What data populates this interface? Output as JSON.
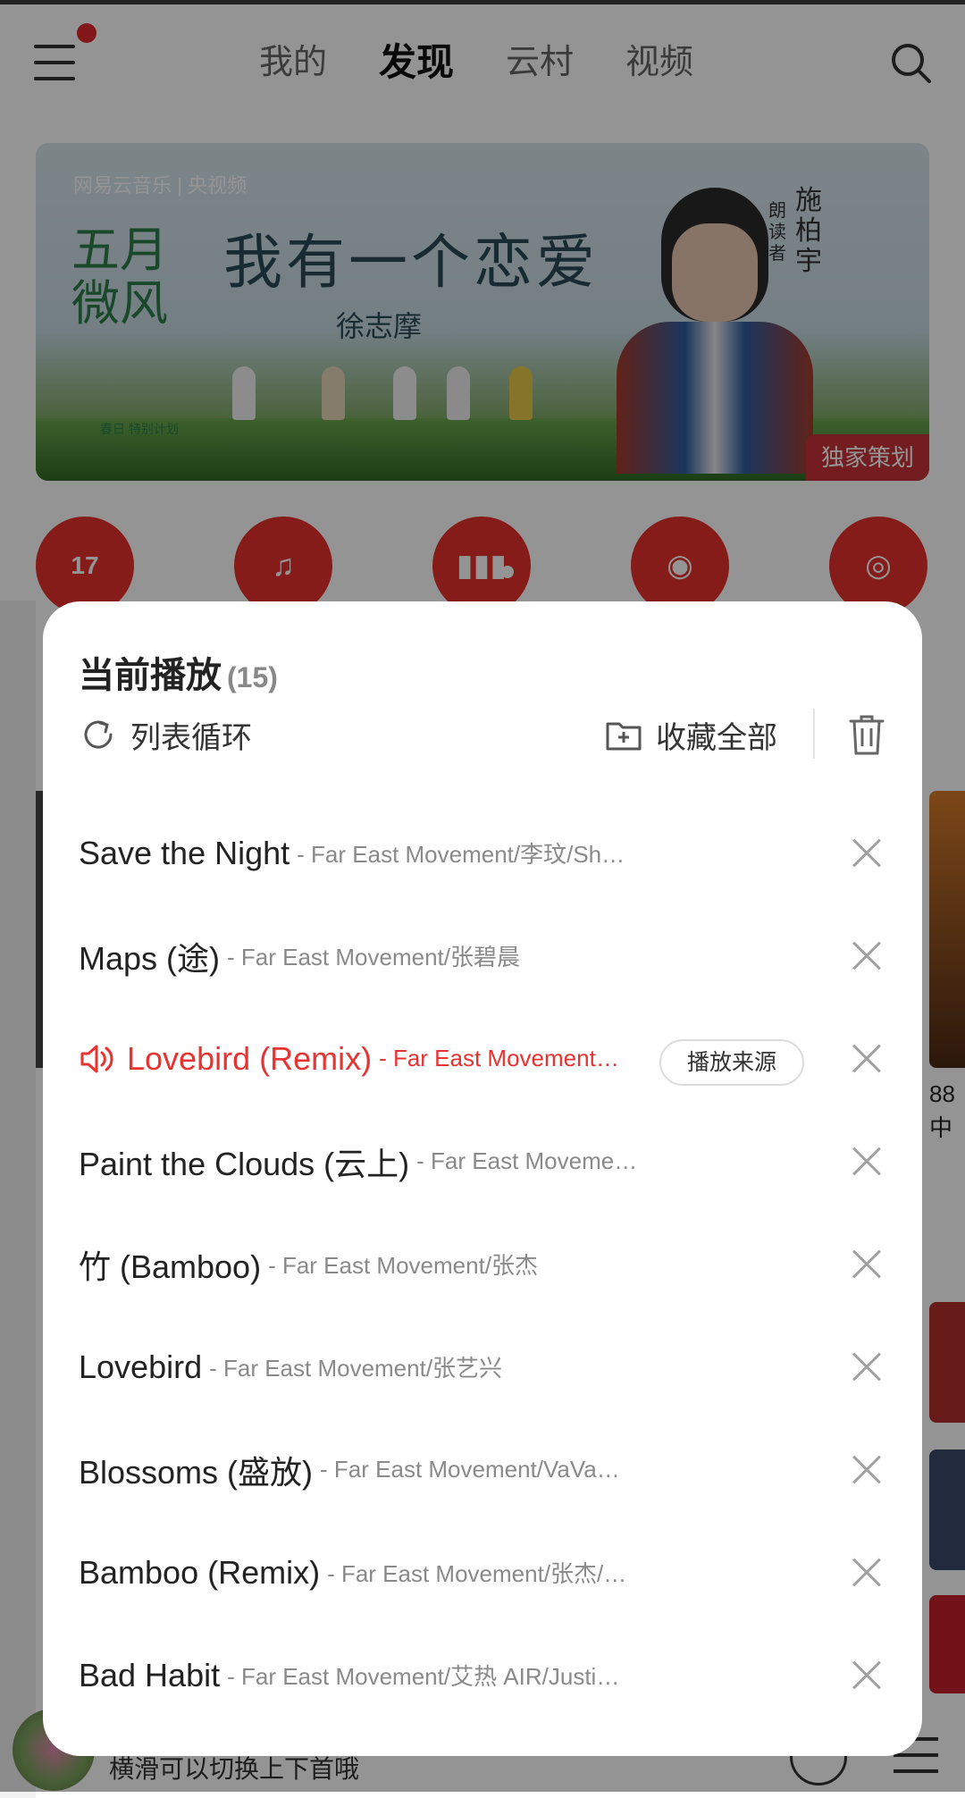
{
  "header": {
    "tabs": [
      "我的",
      "发现",
      "云村",
      "视频"
    ],
    "active_tab": "发现"
  },
  "banner": {
    "logos": "网易云音乐 | 央视频",
    "title": "我有一个恋爱",
    "author": "徐志摩",
    "left_title": "五月微风",
    "left_sub": "春日 特别计划",
    "reader_role": "朗读者",
    "reader_name": "施柏宇",
    "tag": "独家策划"
  },
  "quick_icons": [
    "calendar-icon",
    "playlist-icon",
    "chart-icon",
    "podcast-icon",
    "album-icon"
  ],
  "quick_calendar_day": "17",
  "background_right_text": [
    "88",
    "中"
  ],
  "mini_player": {
    "hint": "横滑可以切换上下首哦"
  },
  "playlist": {
    "title": "当前播放",
    "count": "(15)",
    "loop_label": "列表循环",
    "collect_label": "收藏全部",
    "source_button": "播放来源",
    "items": [
      {
        "song": "Save the Night",
        "artist": "- Far East Movement/李玟/Sh…"
      },
      {
        "song": "Maps (途)",
        "artist": "- Far East Movement/张碧晨"
      },
      {
        "song": "Lovebird (Remix)",
        "artist": "- Far East Movement/…",
        "playing": true
      },
      {
        "song": "Paint the Clouds (云上)",
        "artist": "- Far East Moveme…"
      },
      {
        "song": "竹 (Bamboo)",
        "artist": "- Far East Movement/张杰"
      },
      {
        "song": "Lovebird",
        "artist": "- Far East Movement/张艺兴"
      },
      {
        "song": "Blossoms (盛放)",
        "artist": "- Far East Movement/VaVa…"
      },
      {
        "song": "Bamboo (Remix)",
        "artist": "- Far East Movement/张杰/…"
      },
      {
        "song": "Bad Habit",
        "artist": "- Far East Movement/艾热 AIR/Justi…"
      }
    ]
  },
  "colors": {
    "accent": "#e93232",
    "overlay": "rgba(0,0,0,0.42)"
  }
}
